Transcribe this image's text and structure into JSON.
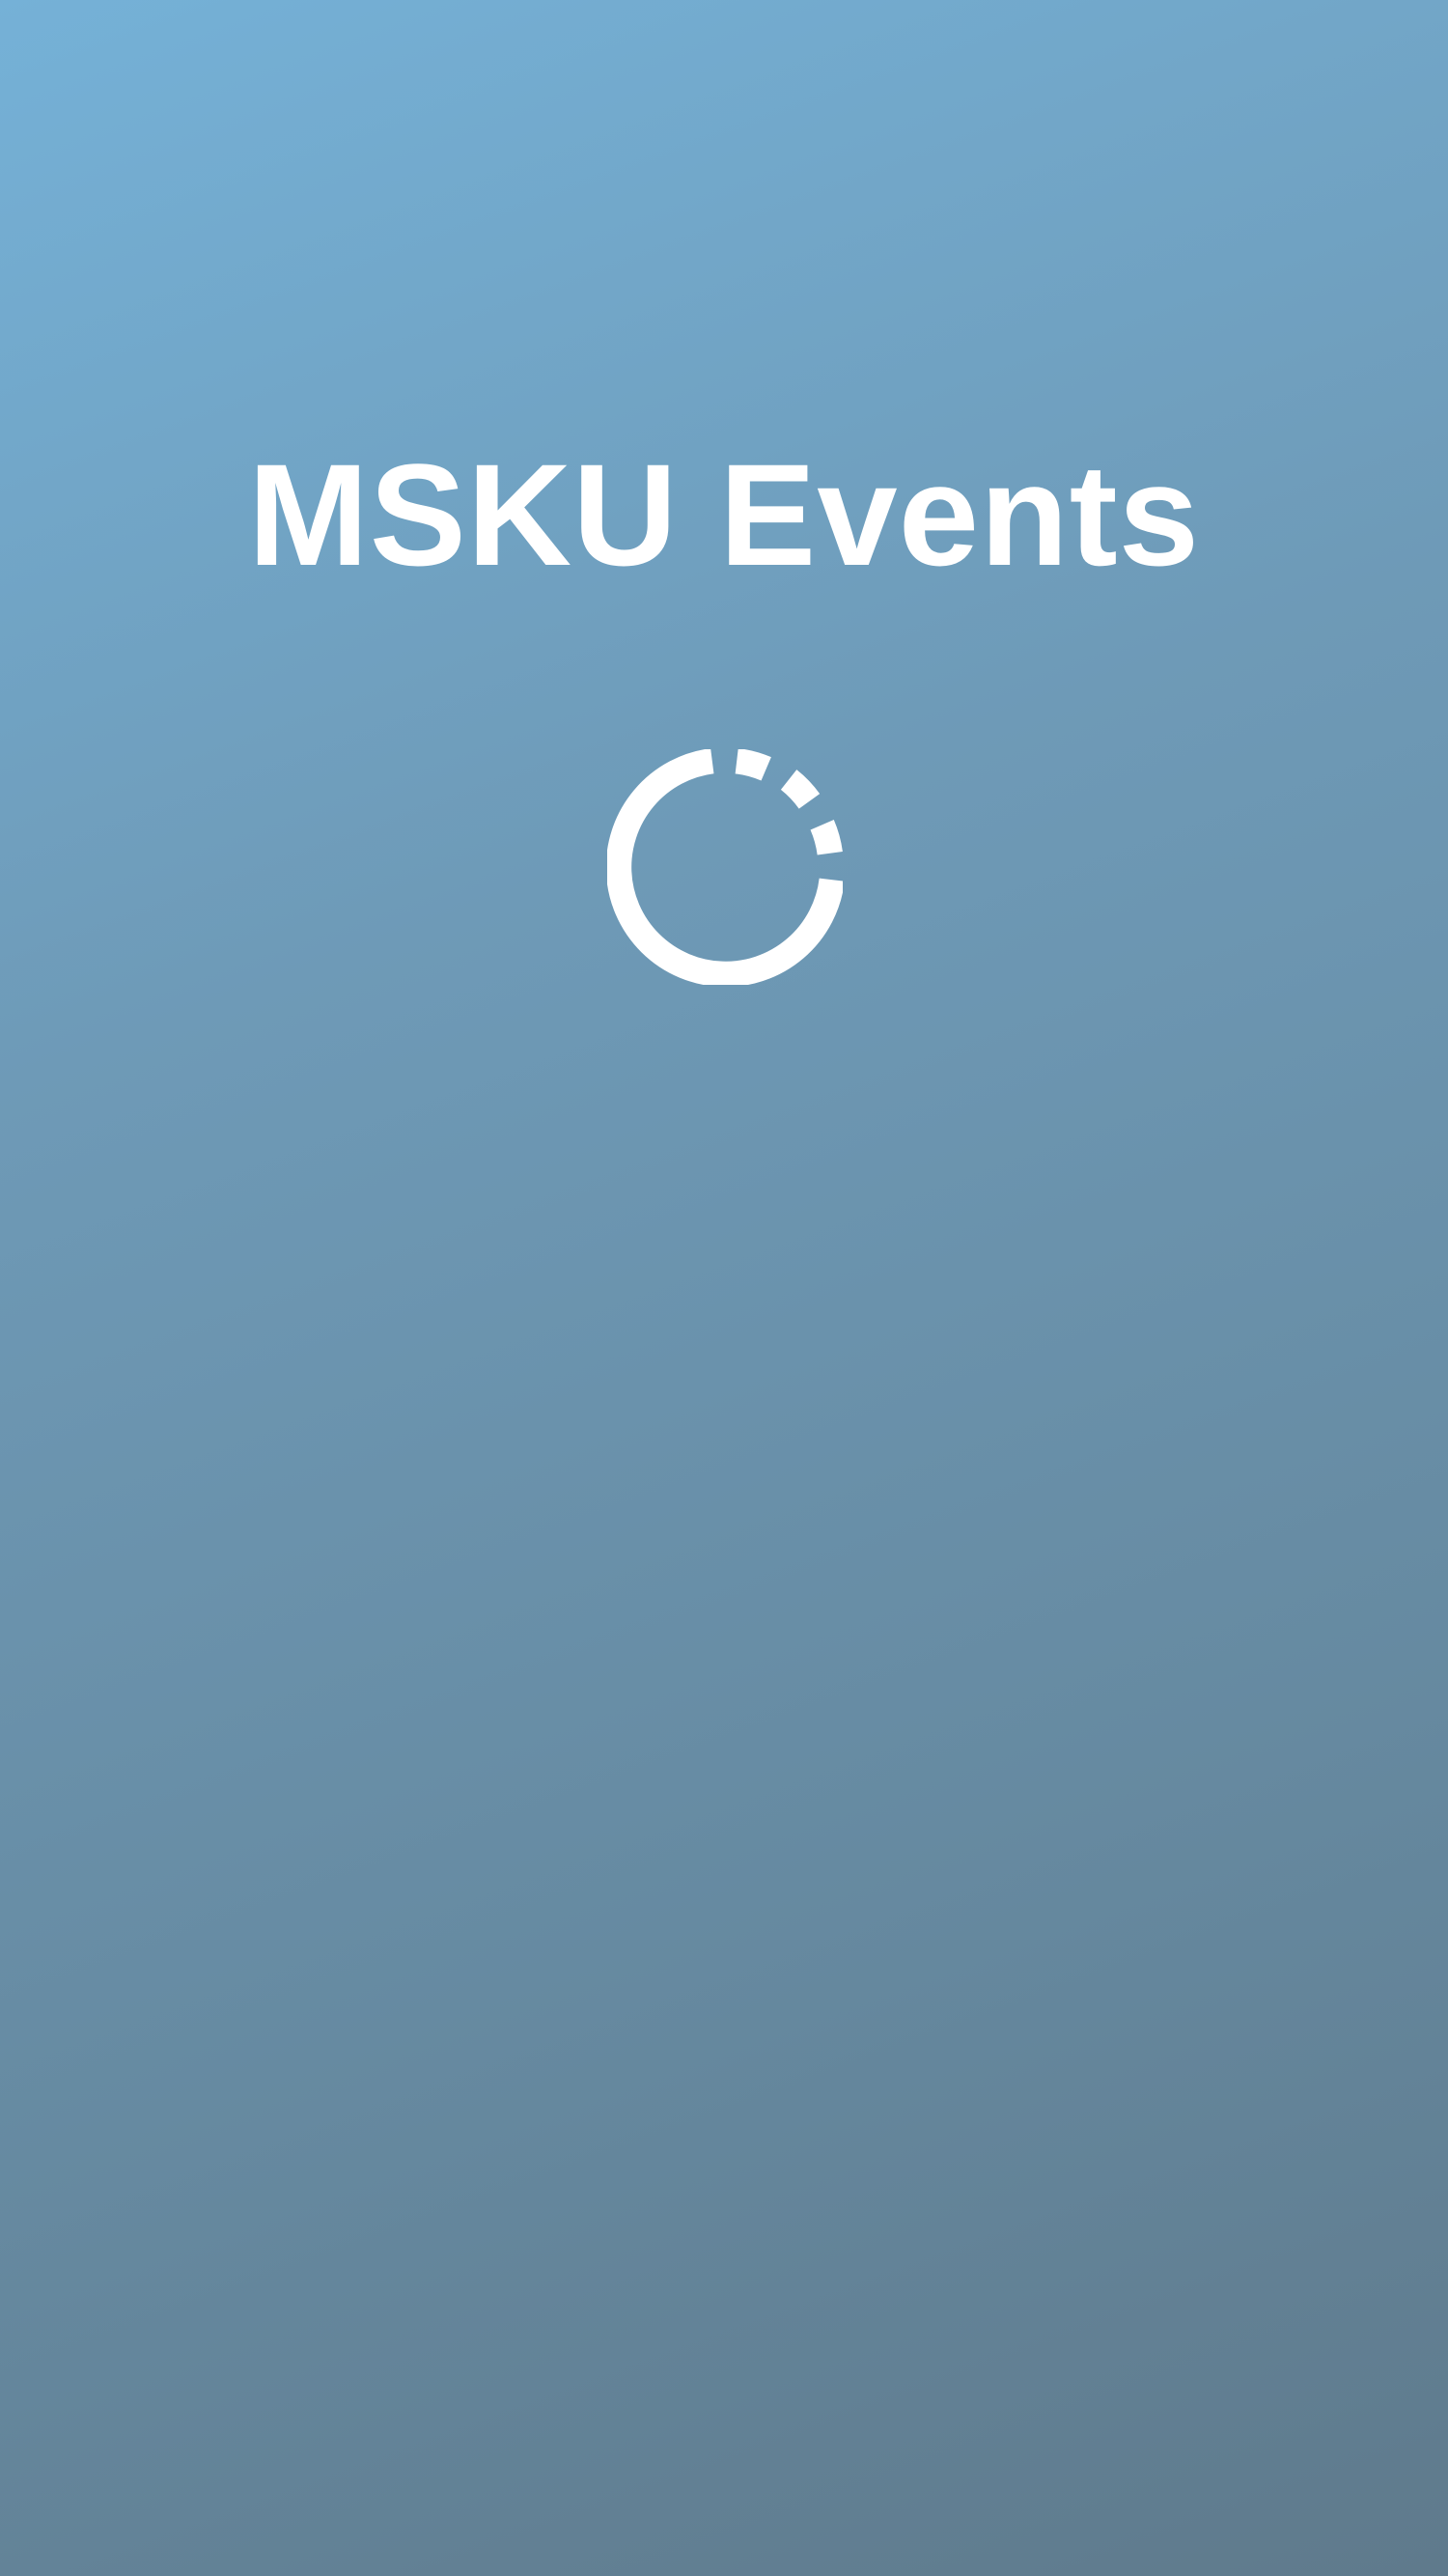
{
  "app": {
    "title": "MSKU Events"
  },
  "loading": {
    "icon": "loading-spinner-icon"
  },
  "colors": {
    "background_top": "#75b1d7",
    "background_bottom": "#5f7a8c",
    "foreground": "#ffffff"
  }
}
